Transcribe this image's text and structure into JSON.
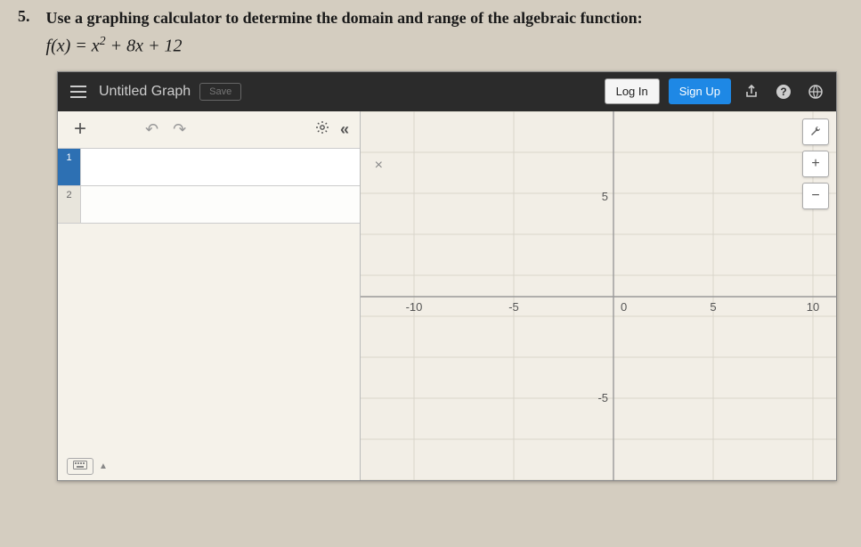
{
  "question": {
    "number": "5.",
    "prompt": "Use a graphing calculator to determine the domain and range of the algebraic function:",
    "formula_html": "f(x) = x² + 8x + 12"
  },
  "topbar": {
    "title": "Untitled Graph",
    "save_label": "Save",
    "login_label": "Log In",
    "signup_label": "Sign Up"
  },
  "sidebar": {
    "add_label": "+",
    "expr1_num": "1",
    "expr2_num": "2",
    "clear_label": "×"
  },
  "graph": {
    "ticks": {
      "neg10": "-10",
      "neg5": "-5",
      "zero": "0",
      "pos5": "5",
      "pos10": "10",
      "yneg5": "-5",
      "ypos5": "5"
    }
  },
  "zoom": {
    "in": "+",
    "out": "−"
  },
  "chart_data": {
    "type": "scatter",
    "title": "",
    "xlabel": "",
    "ylabel": "",
    "xlim": [
      -13,
      11
    ],
    "ylim": [
      -9,
      9
    ],
    "x_ticks": [
      -10,
      -5,
      0,
      5,
      10
    ],
    "y_ticks": [
      -5,
      5
    ],
    "series": []
  }
}
